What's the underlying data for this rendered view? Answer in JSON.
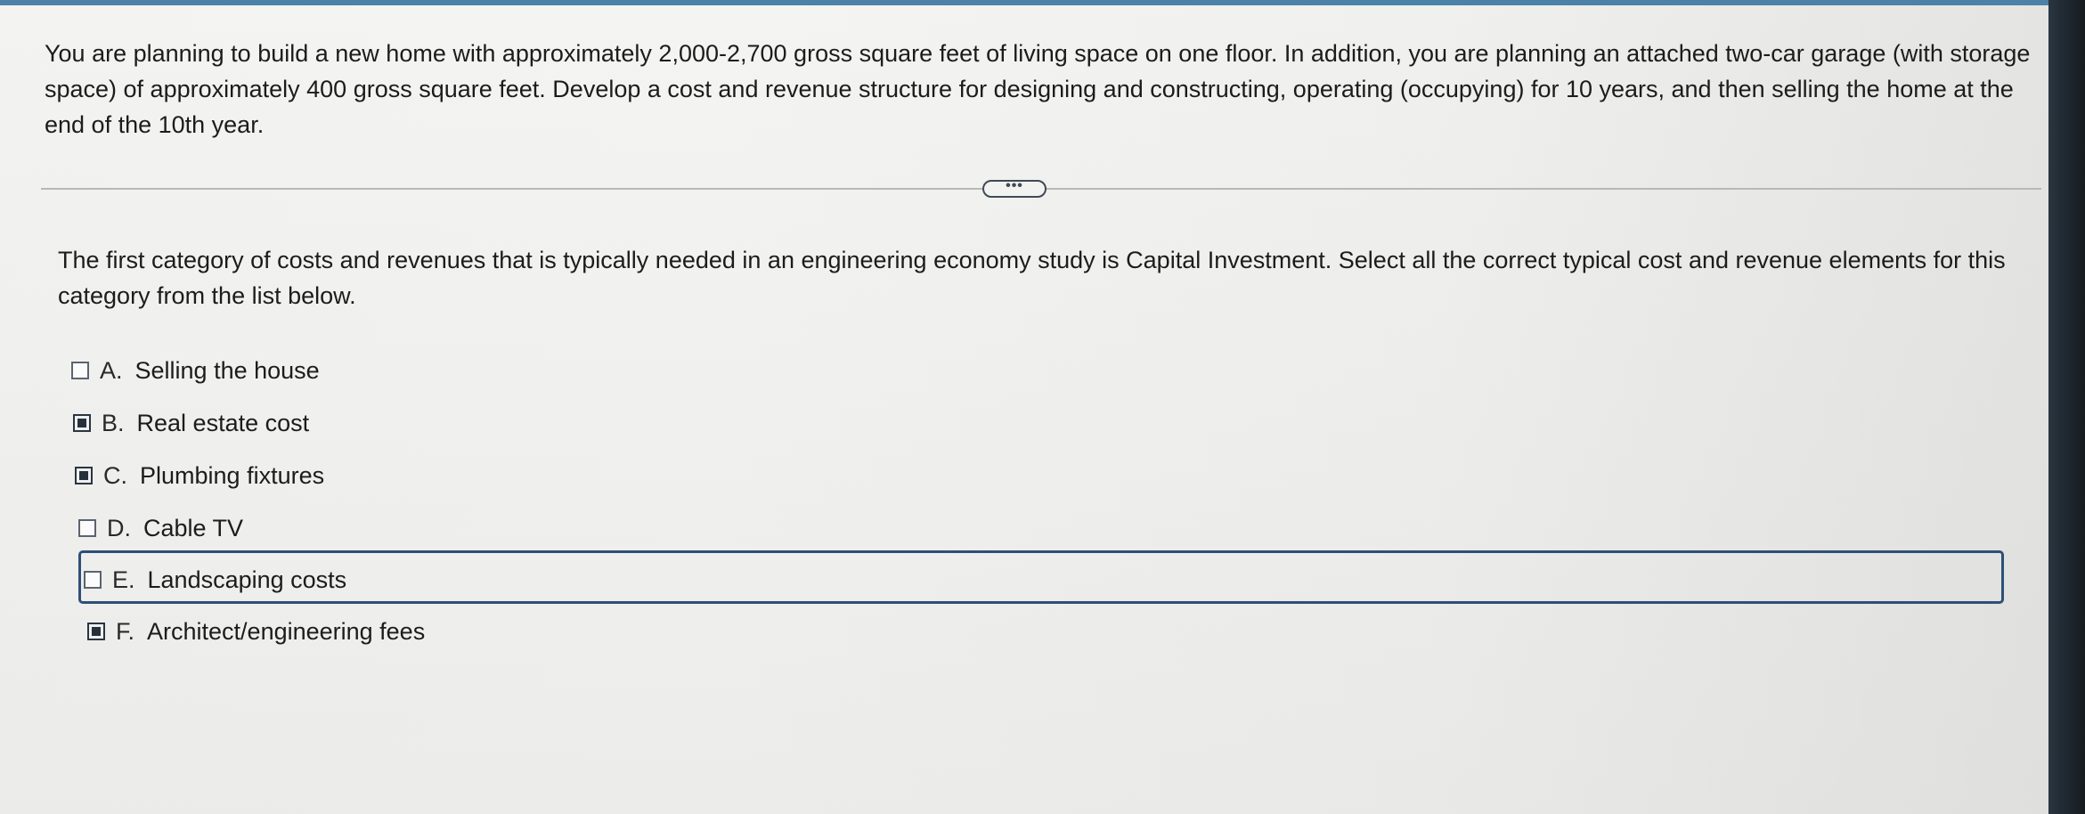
{
  "problem_text": "You are planning to build a new home with approximately 2,000-2,700 gross square feet of living space on one floor. In addition, you are planning an attached two-car garage (with storage space) of approximately 400 gross square feet. Develop a cost and revenue structure for designing and constructing, operating (occupying) for 10 years, and then selling the home at the end of the 10th year.",
  "expand_label": "•••",
  "question_text": "The first category of costs and revenues that is typically needed in an engineering economy study is Capital Investment. Select all the correct typical cost and revenue elements for this category from the list below.",
  "options": [
    {
      "letter": "A.",
      "label": "Selling the house",
      "checked": false
    },
    {
      "letter": "B.",
      "label": "Real estate cost",
      "checked": true
    },
    {
      "letter": "C.",
      "label": "Plumbing fixtures",
      "checked": true
    },
    {
      "letter": "D.",
      "label": "Cable TV",
      "checked": false
    },
    {
      "letter": "E.",
      "label": "Landscaping costs",
      "checked": false,
      "focused": true
    },
    {
      "letter": "F.",
      "label": "Architect/engineering fees",
      "checked": true
    }
  ],
  "colors": {
    "accent": "#4b82a6",
    "focus_border": "#2d4f78",
    "checkbox_fill": "#27313c"
  }
}
